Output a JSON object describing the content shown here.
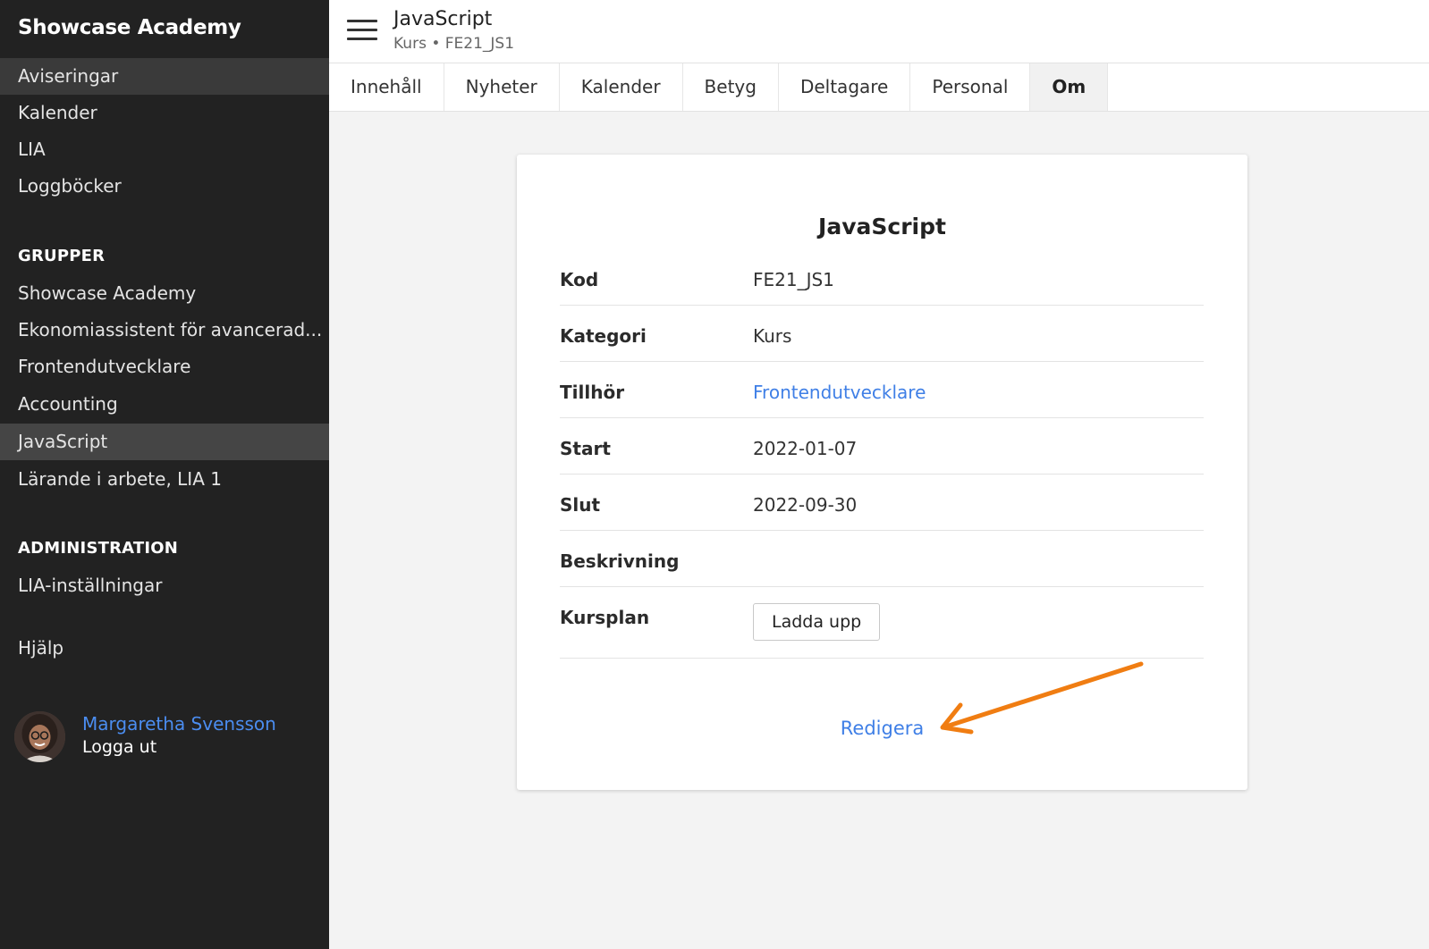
{
  "sidebar": {
    "brand": "Showcase Academy",
    "top_items": [
      {
        "label": "Aviseringar"
      },
      {
        "label": "Kalender"
      },
      {
        "label": "LIA"
      },
      {
        "label": "Loggböcker"
      }
    ],
    "groups_heading": "GRUPPER",
    "groups": [
      {
        "label": "Showcase Academy"
      },
      {
        "label": "Ekonomiassistent för avancerad..."
      },
      {
        "label": "Frontendutvecklare"
      },
      {
        "label": "Accounting"
      },
      {
        "label": "JavaScript"
      },
      {
        "label": "Lärande i arbete, LIA 1"
      }
    ],
    "admin_heading": "ADMINISTRATION",
    "admin_items": [
      {
        "label": "LIA-inställningar"
      }
    ],
    "help": "Hjälp",
    "user": {
      "name": "Margaretha Svensson",
      "logout": "Logga ut"
    }
  },
  "header": {
    "title": "JavaScript",
    "subtitle": "Kurs • FE21_JS1"
  },
  "tabs": [
    {
      "label": "Innehåll"
    },
    {
      "label": "Nyheter"
    },
    {
      "label": "Kalender"
    },
    {
      "label": "Betyg"
    },
    {
      "label": "Deltagare"
    },
    {
      "label": "Personal"
    },
    {
      "label": "Om",
      "active": true
    }
  ],
  "card": {
    "title": "JavaScript",
    "rows": [
      {
        "label": "Kod",
        "value": "FE21_JS1"
      },
      {
        "label": "Kategori",
        "value": "Kurs"
      },
      {
        "label": "Tillhör",
        "value": "Frontendutvecklare"
      },
      {
        "label": "Start",
        "value": "2022-01-07"
      },
      {
        "label": "Slut",
        "value": "2022-09-30"
      },
      {
        "label": "Beskrivning",
        "value": ""
      },
      {
        "label": "Kursplan",
        "button": "Ladda upp"
      }
    ],
    "edit_link": "Redigera"
  },
  "colors": {
    "sidebar_bg": "#222222",
    "link": "#3f7fe6",
    "annotation_arrow": "#f07d12"
  }
}
